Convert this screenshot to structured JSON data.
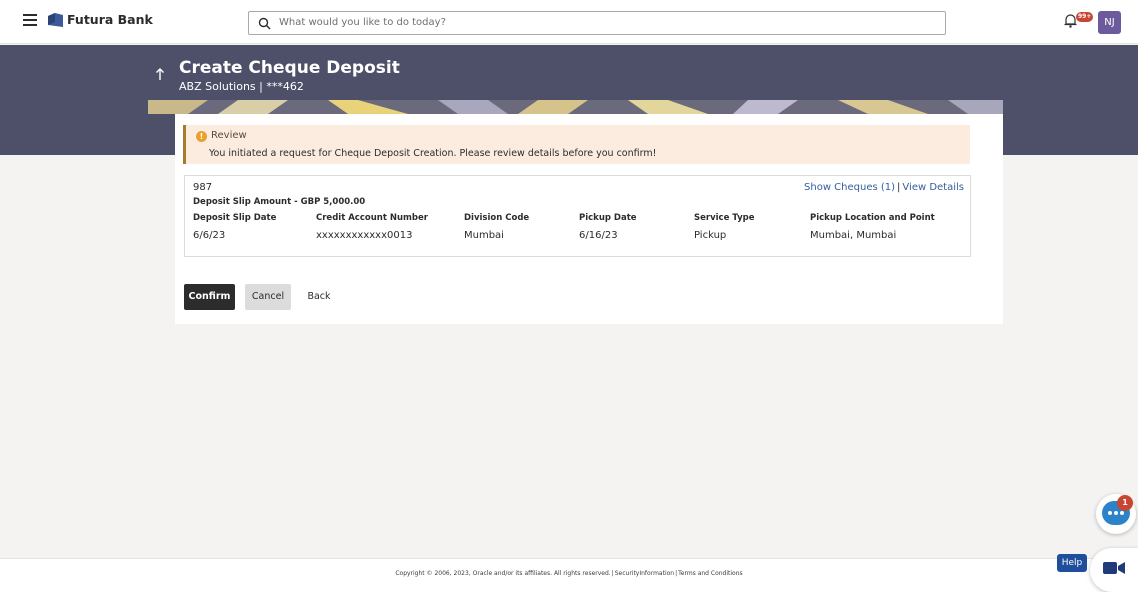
{
  "app": {
    "brand": "Futura Bank",
    "search_placeholder": "What would you like to do today?",
    "notification_badge": "99+",
    "user_initials": "NJ"
  },
  "header": {
    "title": "Create Cheque Deposit",
    "subtitle": "ABZ Solutions | ***462"
  },
  "review": {
    "heading": "Review",
    "message": "You initiated a request for Cheque Deposit Creation. Please review details before you confirm!"
  },
  "deposit": {
    "reference": "987",
    "amount_line": "Deposit Slip Amount - GBP 5,000.00",
    "show_cheques_link": "Show Cheques (1)",
    "separator": "|",
    "view_details_link": "View Details",
    "columns": [
      {
        "label": "Deposit Slip Date",
        "value": "6/6/23"
      },
      {
        "label": "Credit Account Number",
        "value": "xxxxxxxxxxxx0013"
      },
      {
        "label": "Division Code",
        "value": "Mumbai"
      },
      {
        "label": "Pickup Date",
        "value": "6/16/23"
      },
      {
        "label": "Service Type",
        "value": "Pickup"
      },
      {
        "label": "Pickup Location and Point",
        "value": "Mumbai, Mumbai"
      }
    ]
  },
  "actions": {
    "confirm": "Confirm",
    "cancel": "Cancel",
    "back": "Back"
  },
  "footer": {
    "copyright": "Copyright © 2006, 2023, Oracle and/or its affiliates. All rights reserved.",
    "security_link": "SecurityInformation",
    "terms_link": "Terms and Conditions"
  },
  "widgets": {
    "chat_badge": "1",
    "help_label": "Help"
  },
  "colors": {
    "header_band": "#4e5069",
    "primary_button": "#2c2c2c",
    "link": "#365d9d",
    "review_bg": "#fbecdf",
    "alert": "#c74634"
  },
  "icons": [
    "hamburger-icon",
    "bank-logo-icon",
    "search-icon",
    "bell-icon",
    "back-arrow-icon",
    "info-icon",
    "chat-icon",
    "video-icon"
  ]
}
